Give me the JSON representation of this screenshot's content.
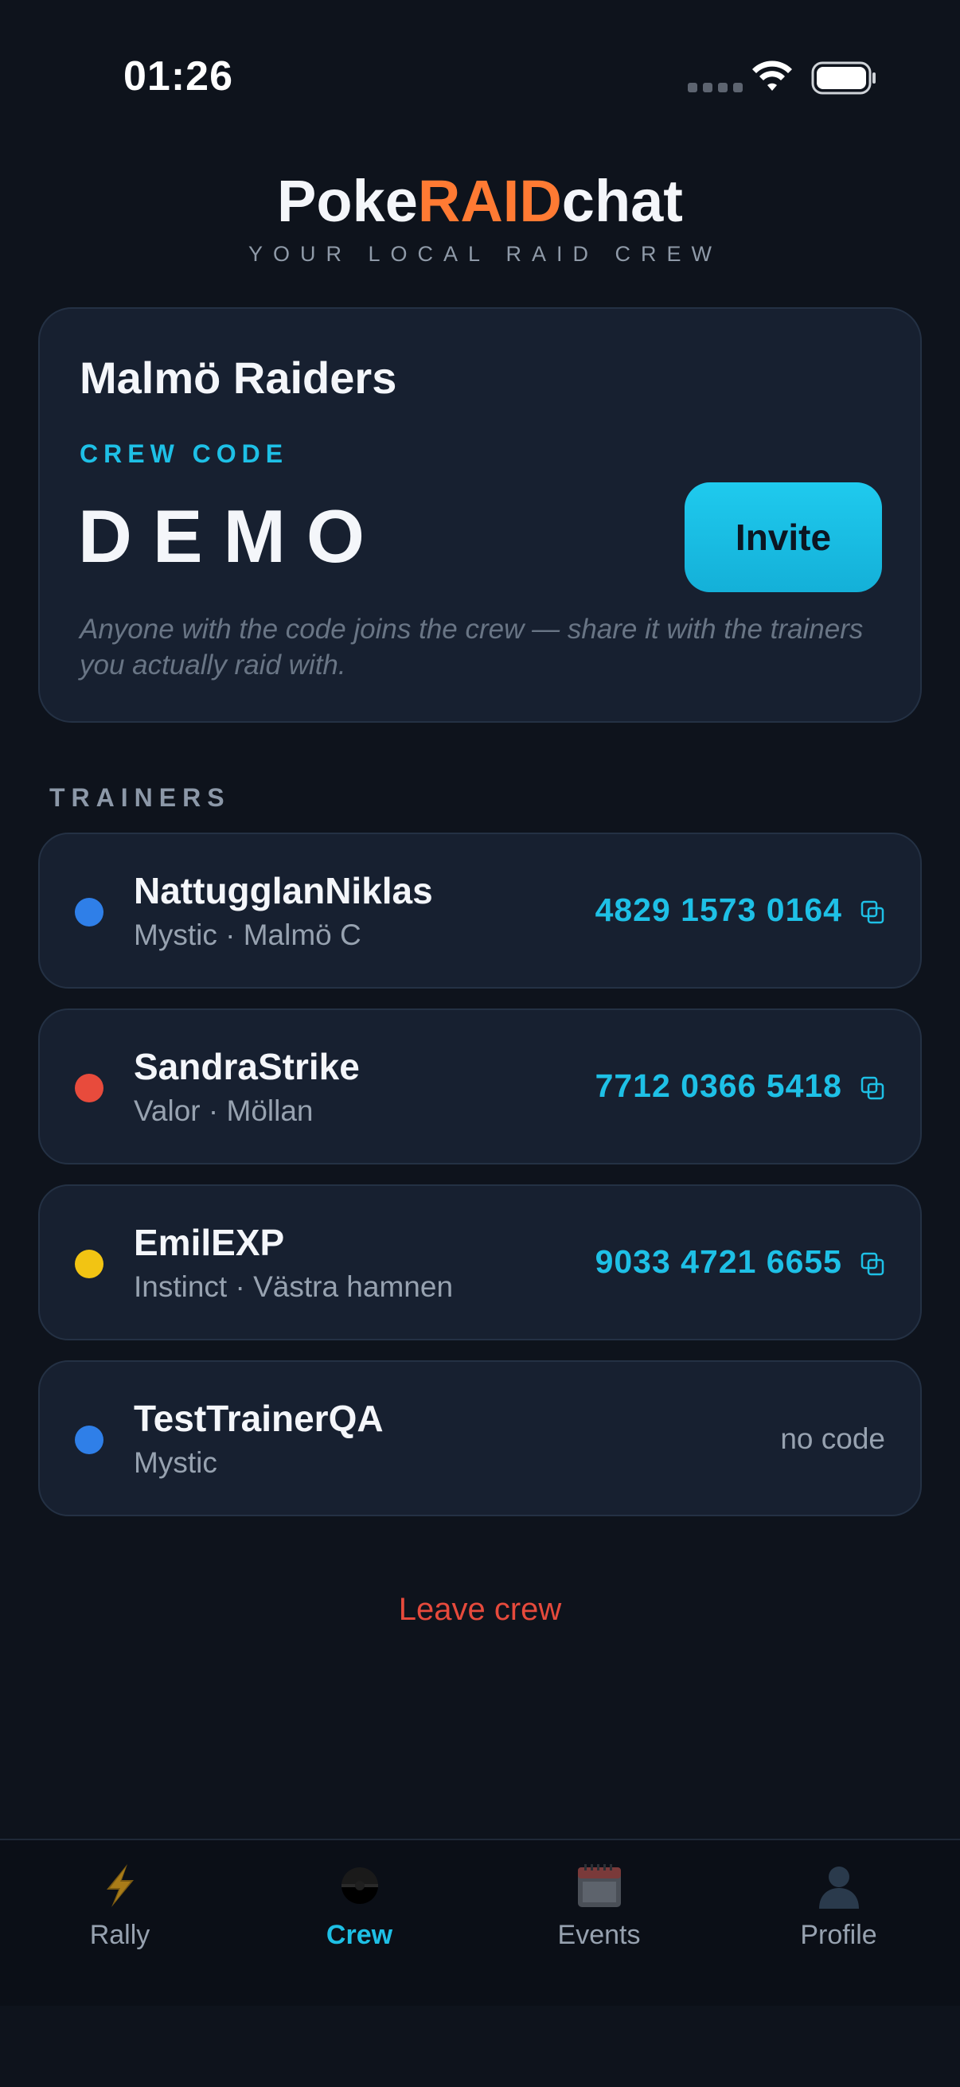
{
  "status_bar": {
    "time": "01:26"
  },
  "header": {
    "brand_part1": "Poke",
    "brand_part2": "RAID",
    "brand_part3": "chat",
    "tagline": "YOUR LOCAL RAID CREW"
  },
  "crew": {
    "name": "Malmö Raiders",
    "code_label": "CREW CODE",
    "code": "DEMO",
    "invite_label": "Invite",
    "hint": "Anyone with the code joins the crew — share it with the trainers you actually raid with."
  },
  "trainers_label": "TRAINERS",
  "trainers": [
    {
      "name": "NattugglanNiklas",
      "meta": "Mystic · Malmö C",
      "friend_code": "4829 1573 0164",
      "team_color": "#2f7fe8"
    },
    {
      "name": "SandraStrike",
      "meta": "Valor · Möllan",
      "friend_code": "7712 0366 5418",
      "team_color": "#e84b3c"
    },
    {
      "name": "EmilEXP",
      "meta": "Instinct · Västra hamnen",
      "friend_code": "9033 4721 6655",
      "team_color": "#f2c413"
    },
    {
      "name": "TestTrainerQA",
      "meta": "Mystic",
      "no_code_label": "no code",
      "team_color": "#2f7fe8"
    }
  ],
  "leave_label": "Leave crew",
  "tabs": [
    {
      "label": "Rally",
      "icon": "lightning-icon"
    },
    {
      "label": "Crew",
      "icon": "pokeball-icon",
      "active": true
    },
    {
      "label": "Events",
      "icon": "calendar-icon"
    },
    {
      "label": "Profile",
      "icon": "person-icon"
    }
  ],
  "colors": {
    "accent": "#1ec0e6",
    "brand_orange": "#ff7a33",
    "danger": "#e64a3c",
    "background": "#0e131c",
    "card": "#172030"
  }
}
